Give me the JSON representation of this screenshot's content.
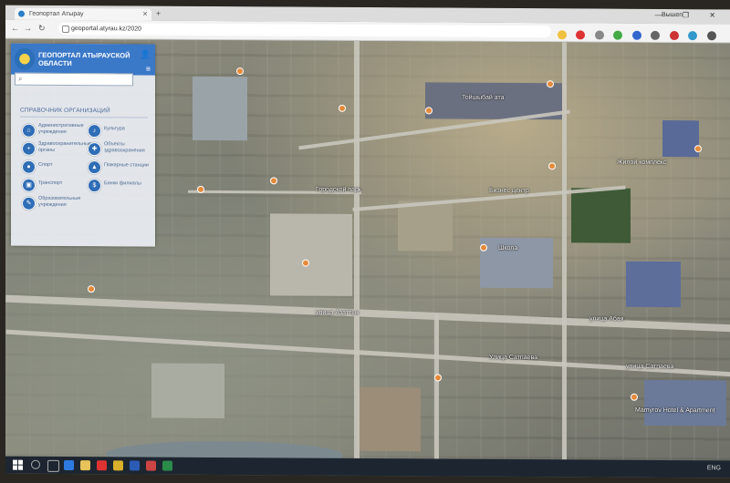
{
  "browser": {
    "tab_title": "Геопортал Атырау",
    "url": "geoportal.atyrau.kz/2020",
    "user_label": "Вышеп",
    "window_controls": "— ❐ ✕"
  },
  "panel": {
    "title": "ГЕОПОРТАЛ АТЫРАУСКОЙ ОБЛАСТИ",
    "search_placeholder": "",
    "directory_title": "СПРАВОЧНИК ОРГАНИЗАЦИЙ",
    "categories": [
      {
        "label": "Административные учреждения",
        "icon": "building-icon"
      },
      {
        "label": "Культура",
        "icon": "theater-icon"
      },
      {
        "label": "Здравоохранительные органы",
        "icon": "medical-icon"
      },
      {
        "label": "Объекты здравоохранения",
        "icon": "hospital-icon"
      },
      {
        "label": "Спорт",
        "icon": "sport-icon"
      },
      {
        "label": "Пожарные станции",
        "icon": "fire-icon"
      },
      {
        "label": "Транспорт",
        "icon": "transport-icon"
      },
      {
        "label": "Банки филиалы",
        "icon": "bank-icon"
      },
      {
        "label": "Образовательные учреждения",
        "icon": "school-icon"
      }
    ]
  },
  "map": {
    "labels": [
      "улица Сатпаева",
      "Улица Сатпаева",
      "улица Азаттык",
      "улица Абая",
      "Тойшыбай ата",
      "Жилой комплекс",
      "Городской парк",
      "Школа",
      "Бизнес центр",
      "Mamyrov Hotel & Apartment"
    ]
  },
  "taskbar": {
    "time": "",
    "tray_text": "ENG"
  },
  "colors": {
    "header_blue": "#3a78c8",
    "icon_blue": "#2f6db6",
    "poi_orange": "#e58a3a"
  }
}
